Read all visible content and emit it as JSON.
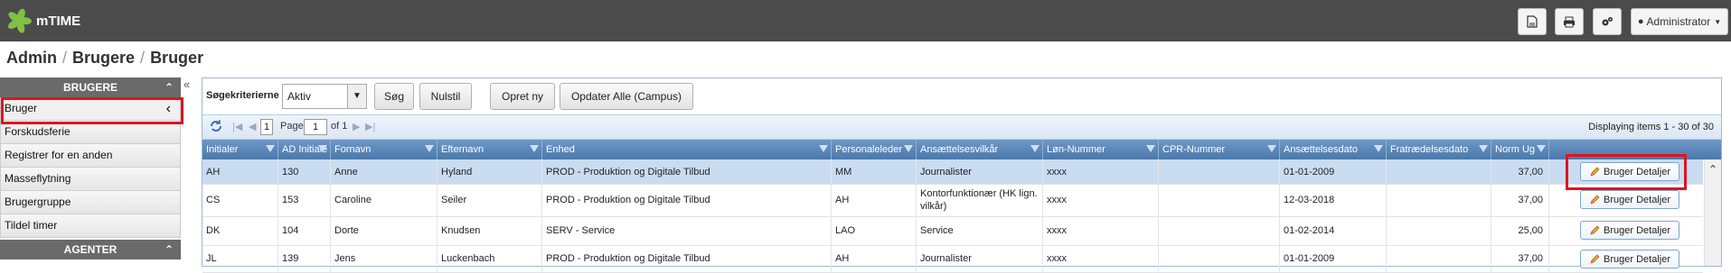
{
  "app": {
    "logo_text": "mTIME"
  },
  "topbar": {
    "user_label": "Administrator"
  },
  "breadcrumb": {
    "items": [
      "Admin",
      "Brugere",
      "Bruger"
    ]
  },
  "sidebar": {
    "section1": "BRUGERE",
    "items": [
      {
        "label": "Bruger"
      },
      {
        "label": "Forskudsferie"
      },
      {
        "label": "Registrer for en anden"
      },
      {
        "label": "Masseflytning"
      },
      {
        "label": "Brugergruppe"
      },
      {
        "label": "Tildel timer"
      }
    ],
    "section2": "AGENTER"
  },
  "search": {
    "label": "Søgekriterierne",
    "status_value": "Aktiv",
    "search_button": "Søg",
    "reset_button": "Nulstil",
    "create_button": "Opret ny",
    "update_button": "Opdater Alle (Campus)"
  },
  "pager": {
    "page_number": "1",
    "page_label": "Page",
    "page_input": "1",
    "of_label": "of 1",
    "display_text": "Displaying items 1 - 30 of 30"
  },
  "columns": [
    "Initialer",
    "AD Initiale",
    "Fornavn",
    "Efternavn",
    "Enhed",
    "Personaleleder",
    "Ansættelsesvilkår",
    "Løn-Nummer",
    "CPR-Nummer",
    "Ansættelsesdato",
    "Fratrædelsesdato",
    "Norm Ug"
  ],
  "rows": [
    {
      "ini": "AH",
      "ad": "130",
      "first": "Anne",
      "last": "Hyland",
      "unit": "PROD - Produktion og Digitale Tilbud",
      "mgr": "MM",
      "terms": "Journalister",
      "salary": "xxxx",
      "cpr": "",
      "start": "01-01-2009",
      "end": "",
      "norm": "37,00",
      "action": "Bruger Detaljer"
    },
    {
      "ini": "CS",
      "ad": "153",
      "first": "Caroline",
      "last": "Seiler",
      "unit": "PROD - Produktion og Digitale Tilbud",
      "mgr": "AH",
      "terms": "Kontorfunktionær (HK lign. vilkår)",
      "salary": "xxxx",
      "cpr": "",
      "start": "12-03-2018",
      "end": "",
      "norm": "37,00",
      "action": "Bruger Detaljer"
    },
    {
      "ini": "DK",
      "ad": "104",
      "first": "Dorte",
      "last": "Knudsen",
      "unit": "SERV - Service",
      "mgr": "LAO",
      "terms": "Service",
      "salary": "xxxx",
      "cpr": "",
      "start": "01-02-2014",
      "end": "",
      "norm": "25,00",
      "action": "Bruger Detaljer"
    },
    {
      "ini": "JL",
      "ad": "139",
      "first": "Jens",
      "last": "Luckenbach",
      "unit": "PROD - Produktion og Digitale Tilbud",
      "mgr": "AH",
      "terms": "Journalister",
      "salary": "xxxx",
      "cpr": "",
      "start": "01-01-2009",
      "end": "",
      "norm": "37,00",
      "action": "Bruger Detaljer"
    }
  ]
}
